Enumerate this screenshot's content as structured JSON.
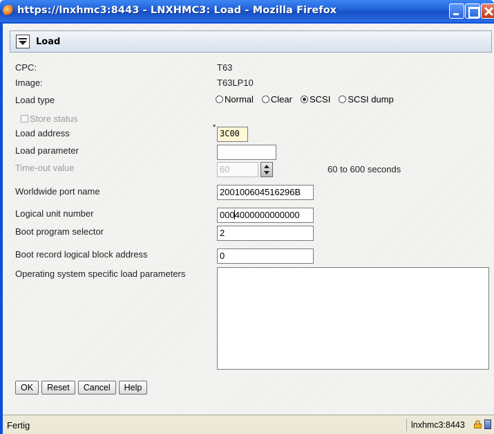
{
  "window": {
    "title": "https://lnxhmc3:8443 - LNXHMC3: Load - Mozilla Firefox"
  },
  "panel": {
    "title": "Load"
  },
  "form": {
    "cpc_label": "CPC:",
    "cpc_value": "T63",
    "image_label": "Image:",
    "image_value": "T63LP10",
    "load_type_label": "Load type",
    "load_type_options": [
      "Normal",
      "Clear",
      "SCSI",
      "SCSI dump"
    ],
    "load_type_selected": "SCSI",
    "store_status_label": "Store status",
    "load_address_label": "Load address",
    "load_address_required_marker": "*",
    "load_address_value": "3C00",
    "load_parameter_label": "Load parameter",
    "load_parameter_value": "",
    "timeout_label": "Time-out value",
    "timeout_value": "60",
    "timeout_range": "60 to 600 seconds",
    "wwpn_label": "Worldwide port name",
    "wwpn_value": "200100604516296B",
    "lun_label": "Logical unit number",
    "lun_value_before_cursor": "000",
    "lun_value_after_cursor": "4000000000000",
    "boot_selector_label": "Boot program selector",
    "boot_selector_value": "2",
    "boot_record_label": "Boot record logical block address",
    "boot_record_value": "0",
    "os_params_label": "Operating system specific load parameters",
    "os_params_value": ""
  },
  "buttons": {
    "ok": "OK",
    "reset": "Reset",
    "cancel": "Cancel",
    "help": "Help"
  },
  "statusbar": {
    "text": "Fertig",
    "host": "lnxhmc3:8443"
  }
}
